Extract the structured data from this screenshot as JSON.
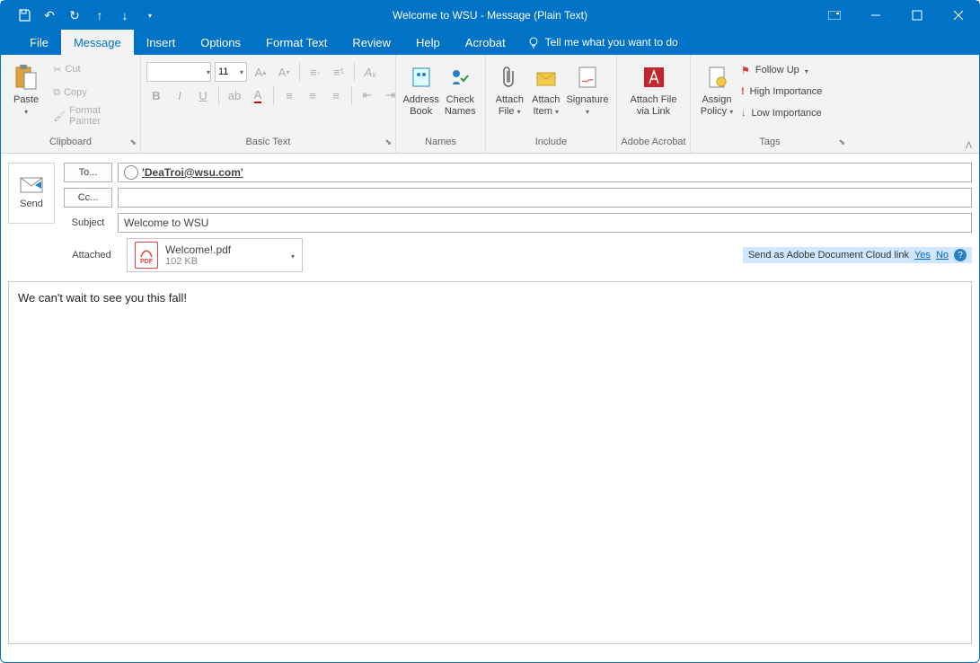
{
  "titlebar": {
    "title": "Welcome to WSU  -  Message (Plain Text)"
  },
  "qat": {
    "save": "",
    "undo": "",
    "redo": "",
    "up": "",
    "down": ""
  },
  "menu": {
    "tabs": [
      "File",
      "Message",
      "Insert",
      "Options",
      "Format Text",
      "Review",
      "Help",
      "Acrobat"
    ],
    "active": 1,
    "tellme": "Tell me what you want to do"
  },
  "ribbon": {
    "clipboard": {
      "label": "Clipboard",
      "paste": "Paste",
      "cut": "Cut",
      "copy": "Copy",
      "formatPainter": "Format Painter"
    },
    "basicText": {
      "label": "Basic Text",
      "fontSize": "11"
    },
    "names": {
      "label": "Names",
      "addressBook": "Address\nBook",
      "checkNames": "Check\nNames"
    },
    "include": {
      "label": "Include",
      "attachFile": "Attach\nFile",
      "attachItem": "Attach\nItem",
      "signature": "Signature"
    },
    "adobe": {
      "label": "Adobe Acrobat",
      "attachLink": "Attach File\nvia Link"
    },
    "policy": {
      "label": "",
      "assign": "Assign\nPolicy"
    },
    "tags": {
      "label": "Tags",
      "followUp": "Follow Up",
      "highImportance": "High Importance",
      "lowImportance": "Low Importance"
    }
  },
  "compose": {
    "send": "Send",
    "to": "To...",
    "cc": "Cc...",
    "subjectLabel": "Subject",
    "recipient": "'DeaTroi@wsu.com'",
    "subject": "Welcome to WSU",
    "attachedLabel": "Attached",
    "attachment": {
      "name": "Welcome!.pdf",
      "size": "102 KB"
    },
    "adobeCloud": {
      "text": "Send as Adobe Document Cloud link",
      "yes": "Yes",
      "no": "No"
    },
    "body": "We can't wait to see you this fall!"
  }
}
